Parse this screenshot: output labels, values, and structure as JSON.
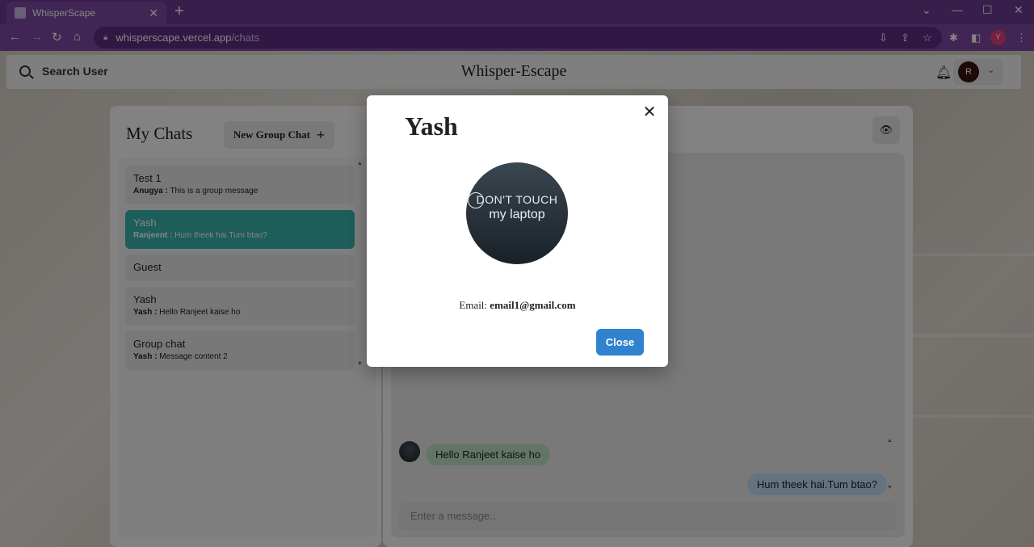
{
  "browser": {
    "tab_title": "WhisperScape",
    "url_host": "whisperscape.vercel.app",
    "url_path": "/chats",
    "profile_initial": "Y"
  },
  "header": {
    "search_label": "Search User",
    "app_title": "Whisper-Escape",
    "avatar_initial": "R"
  },
  "chats": {
    "title": "My Chats",
    "new_group_label": "New Group Chat",
    "items": [
      {
        "name": "Test 1",
        "sender": "Anugya :",
        "message": "This is a group message",
        "active": false
      },
      {
        "name": "Yash",
        "sender": "Ranjeent :",
        "message": "Hum theek hai.Tum btao?",
        "active": true
      },
      {
        "name": "Guest",
        "sender": "",
        "message": "",
        "active": false
      },
      {
        "name": "Yash",
        "sender": "Yash :",
        "message": "Hello Ranjeet kaise ho",
        "active": false
      },
      {
        "name": "Group chat",
        "sender": "Yash :",
        "message": "Message content 2",
        "active": false
      }
    ]
  },
  "chatbox": {
    "messages": [
      {
        "text": "Hello Ranjeet kaise ho",
        "direction": "in"
      },
      {
        "text": "Hum theek hai.Tum btao?",
        "direction": "out"
      }
    ],
    "input_placeholder": "Enter a message.."
  },
  "modal": {
    "title": "Yash",
    "pic_line1": "DON'T TOUCH",
    "pic_line2": "my laptop",
    "email_label": "Email:",
    "email_value": "email1@gmail.com",
    "close_label": "Close"
  },
  "colors": {
    "active_chat": "#38b2ac",
    "close_button": "#3182ce",
    "in_bubble": "#bee3c4",
    "out_bubble": "#bedcf4"
  }
}
